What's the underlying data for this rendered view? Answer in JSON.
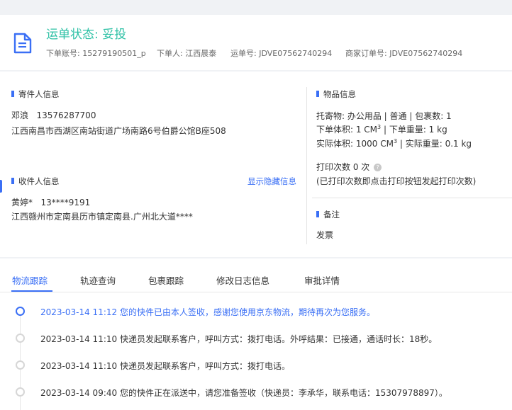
{
  "header": {
    "status_title": "运单状态: 妥投",
    "account_label": "下单账号:",
    "account_value": "15279190501_p",
    "placer_label": "下单人:",
    "placer_value": "江西晨泰",
    "waybill_label": "运单号:",
    "waybill_value": "JDVE07562740294",
    "merchant_order_label": "商家订单号:",
    "merchant_order_value": "JDVE07562740294"
  },
  "sender": {
    "title": "寄件人信息",
    "name": "邓浪",
    "phone": "13576287700",
    "address": "江西南昌市西湖区南站街道广场南路6号伯爵公馆B座508"
  },
  "receiver": {
    "title": "收件人信息",
    "toggle_link": "显示隐藏信息",
    "name": "黄婷*",
    "phone": "13****9191",
    "address": "江西赣州市定南县历市镇定南县.广州北大道****"
  },
  "goods": {
    "title": "物品信息",
    "line1": "托寄物:  办公用品 | 普通  |  包裹数:  1",
    "line2_a": "下单体积:    1 CM",
    "line2_b": "  |  下单重量:   1 kg",
    "line3_a": "实际体积:    1000 CM",
    "line3_b": "  |  实际重量:   0.1 kg",
    "superscript": "3",
    "print_count": "打印次数   0 次",
    "help_icon_glyph": "?",
    "print_hint": "(已打印次数即点击打印按钮发起打印次数)"
  },
  "remark": {
    "title": "备注",
    "value": "发票"
  },
  "tabs": [
    {
      "label": "物流跟踪",
      "active": true
    },
    {
      "label": "轨迹查询",
      "active": false
    },
    {
      "label": "包裹跟踪",
      "active": false
    },
    {
      "label": "修改日志信息",
      "active": false
    },
    {
      "label": "审批详情",
      "active": false
    }
  ],
  "timeline": [
    {
      "text": "2023-03-14 11:12  您的快件已由本人签收，感谢您使用京东物流，期待再次为您服务。",
      "active": true
    },
    {
      "text": "2023-03-14 11:10  快递员发起联系客户，呼叫方式：拨打电话。外呼结果：已接通，通话时长：18秒。",
      "active": false
    },
    {
      "text": "2023-03-14 11:10  快递员发起联系客户，呼叫方式：拨打电话。",
      "active": false
    },
    {
      "text": "2023-03-14 09:40  您的快件正在派送中，请您准备签收（快递员：李承华，联系电话：15307978897）。",
      "active": false
    }
  ],
  "colors": {
    "accent": "#3a6ff5",
    "status_green": "#2fc1a6"
  },
  "icons": {
    "document": "document-icon",
    "help": "help-icon"
  }
}
